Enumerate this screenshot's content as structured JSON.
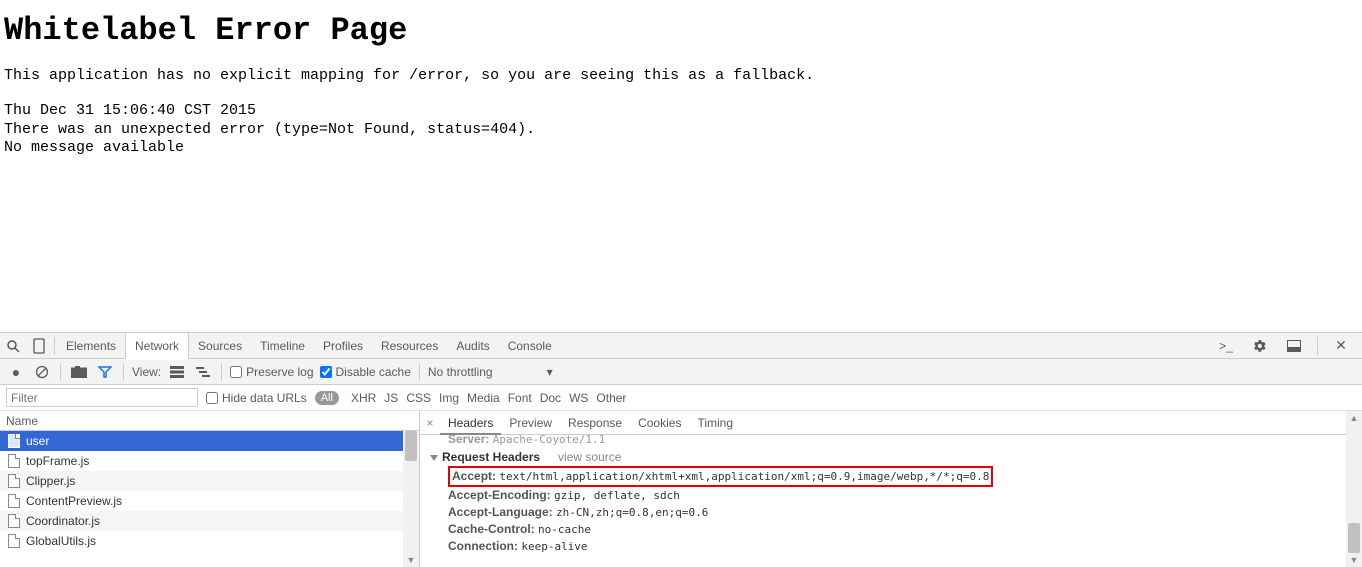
{
  "page": {
    "title": "Whitelabel Error Page",
    "line1": "This application has no explicit mapping for /error, so you are seeing this as a fallback.",
    "line2": "Thu Dec 31 15:06:40 CST 2015",
    "line3": "There was an unexpected error (type=Not Found, status=404).",
    "line4": "No message available"
  },
  "devtools": {
    "tabs": [
      "Elements",
      "Network",
      "Sources",
      "Timeline",
      "Profiles",
      "Resources",
      "Audits",
      "Console"
    ],
    "active_tab": "Network",
    "toolbar": {
      "view_label": "View:",
      "preserve_log": "Preserve log",
      "disable_cache": "Disable cache",
      "throttling": "No throttling"
    },
    "filterbar": {
      "filter_placeholder": "Filter",
      "hide_data_urls": "Hide data URLs",
      "all_pill": "All",
      "types": [
        "XHR",
        "JS",
        "CSS",
        "Img",
        "Media",
        "Font",
        "Doc",
        "WS",
        "Other"
      ]
    },
    "reqlist": {
      "header": "Name",
      "rows": [
        "user",
        "topFrame.js",
        "Clipper.js",
        "ContentPreview.js",
        "Coordinator.js",
        "GlobalUtils.js"
      ]
    },
    "detail": {
      "tabs": [
        "Headers",
        "Preview",
        "Response",
        "Cookies",
        "Timing"
      ],
      "active_tab": "Headers",
      "truncated_server_k": "Server:",
      "truncated_server_v": "Apache-Coyote/1.1",
      "section_title": "Request Headers",
      "view_source": "view source",
      "headers": [
        {
          "k": "Accept:",
          "v": "text/html,application/xhtml+xml,application/xml;q=0.9,image/webp,*/*;q=0.8",
          "hl": true
        },
        {
          "k": "Accept-Encoding:",
          "v": "gzip, deflate, sdch"
        },
        {
          "k": "Accept-Language:",
          "v": "zh-CN,zh;q=0.8,en;q=0.6"
        },
        {
          "k": "Cache-Control:",
          "v": "no-cache"
        },
        {
          "k": "Connection:",
          "v": "keep-alive"
        }
      ]
    }
  }
}
